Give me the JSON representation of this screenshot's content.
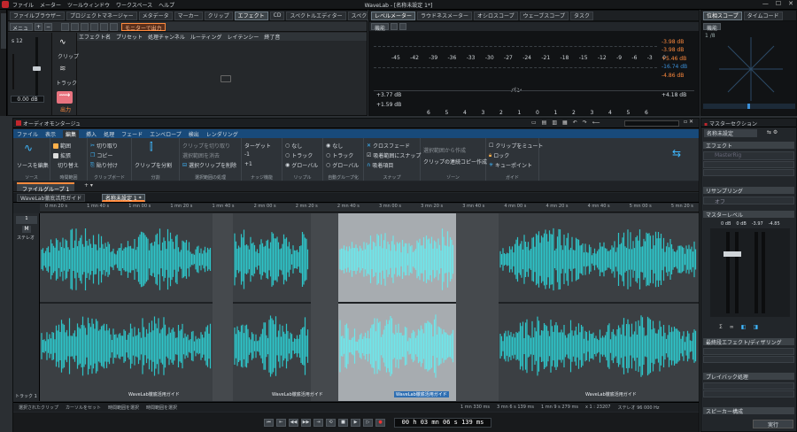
{
  "window": {
    "title": "WaveLab - [名称未設定 1*]",
    "menu": [
      "ファイル",
      "メーター",
      "ツールウィンドウ",
      "ワークスペース",
      "ヘルプ"
    ]
  },
  "top_tabs_left": [
    "ファイルブラウザー",
    "プロジェクトマネージャー",
    "メタデータ",
    "マーカー",
    "クリップ",
    "エフェクト",
    "CD",
    "スペクトルエディター",
    "スペクトルスコープ"
  ],
  "top_tabs_mid": [
    "レベルメーター",
    "ラウドネスメーター",
    "オシロスコープ",
    "ウェーブスコープ",
    "タスク"
  ],
  "top_tabs_right": [
    "位相スコープ",
    "タイムコード"
  ],
  "effects_panel": {
    "menu_label": "メニュー",
    "monitor_out": "モニターで出力",
    "columns": [
      "エフェクト名",
      "プリセット",
      "処理チャンネル",
      "ルーティング",
      "レイテンシー",
      "終了音"
    ],
    "clip_label": "クリップ",
    "track_label": "トラック",
    "output_label": "出力",
    "gain_value": "0.00 dB",
    "s12": "s 12"
  },
  "level_meter": {
    "function_label": "機能",
    "scale": [
      "-45",
      "-42",
      "-39",
      "-36",
      "-33",
      "-30",
      "-27",
      "-24",
      "-21",
      "-18",
      "-15",
      "-12",
      "-9",
      "-6",
      "-3",
      "0"
    ],
    "pan_label": "パン",
    "right_values": [
      "-3.98 dB",
      "-3.98 dB",
      "+5.46 dB",
      "-16.74 dB",
      "-4.86 dB"
    ],
    "low_left": [
      "+3.77 dB",
      "+1.59 dB"
    ],
    "low_right": "+4.18 dB",
    "bottom_scale": [
      "6",
      "5",
      "4",
      "3",
      "2",
      "1",
      "0",
      "1",
      "2",
      "3",
      "4",
      "5",
      "6"
    ]
  },
  "phase_scope": {
    "function_label": "機能",
    "value": "1 /8"
  },
  "audio_montage": {
    "title": "オーディオモンタージュ",
    "ribbon_tabs": [
      "ファイル",
      "表示",
      "編集",
      "挿入",
      "処理",
      "フェード",
      "エンベロープ",
      "検出",
      "レンダリング"
    ],
    "active_tab": "編集",
    "groups": [
      {
        "label": "ソース",
        "items": [
          "ソースを編集"
        ]
      },
      {
        "label": "時間範囲",
        "items": [
          "範囲",
          "拡張",
          "切り替え"
        ]
      },
      {
        "label": "クリップボード",
        "items": [
          "切り取り",
          "コピー",
          "貼り付け"
        ]
      },
      {
        "label": "分割",
        "items": [
          "クリップを分割"
        ]
      },
      {
        "label": "選択範囲の処理",
        "items": [
          "クリップを切り取り",
          "選択範囲を消去",
          "選択クリップを削除"
        ]
      },
      {
        "label": "ナッジ機能",
        "items": [
          "ターゲット",
          "-1",
          "+1"
        ]
      },
      {
        "label": "リップル",
        "items": [
          "なし",
          "トラック",
          "グローバル"
        ]
      },
      {
        "label": "自動グループ化",
        "items": [
          "なし",
          "トラック",
          "グローバル"
        ]
      },
      {
        "label": "スナップ",
        "items": [
          "クロスフェード",
          "吸着範囲にスナップ",
          "吸着項目"
        ]
      },
      {
        "label": "ゾーン",
        "items": [
          "選択範囲から作成",
          "クリップの連続コピー作成"
        ]
      },
      {
        "label": "ガイド",
        "items": [
          "クリップをミュート",
          "ロック",
          "キューポイント"
        ]
      }
    ],
    "file_group": "ファイルグループ 1",
    "doc_tabs": [
      "WaveLab徹底活用ガイド",
      "名称未設定 1 *"
    ],
    "track_label": "ステレオ",
    "track_name": "トラック 1",
    "clips": [
      "WaveLab徹底活用ガイド",
      "WaveLab徹底活用ガイド",
      "WaveLab徹底活用ガイド",
      "WaveLab徹底活用ガイド"
    ],
    "ruler": [
      "0 mn 20 s",
      "1 mn 40 s",
      "1 mn 00 s",
      "1 mn 20 s",
      "1 mn 40 s",
      "2 mn 00 s",
      "2 mn 20 s",
      "2 mn 40 s",
      "3 mn 00 s",
      "3 mn 20 s",
      "3 mn 40 s",
      "4 mn 00 s",
      "4 mn 20 s",
      "4 mn 40 s",
      "5 mn 00 s",
      "5 mn 20 s"
    ],
    "status": [
      "選択されたクリップ",
      "カーソルをセット",
      "時間範囲を選択",
      "時間範囲を選択"
    ],
    "status_right": [
      "1 mn 330 ms",
      "3 mn 6 s 139 ms",
      "1 mn 9 s 279 ms",
      "x 1 : 23207",
      "ステレオ 96 000 Hz"
    ],
    "transport_time": "00 h 03 mn 06 s 139 ms"
  },
  "master": {
    "title": "マスターセクション",
    "preset": "名称未設定",
    "effects": "エフェクト",
    "effect_slot": "MasterRig",
    "resampling": "リサンプリング",
    "resample_slot": "オフ",
    "master_level": "マスターレベル",
    "level_values": [
      "0 dB",
      "0 dB",
      "-3.97",
      "-4.85"
    ],
    "final_effects": "最終段エフェクト/ディザリング",
    "playback": "プレイバック処理",
    "speaker": "スピーカー構成",
    "render": "実行"
  },
  "colors": {
    "accent": "#ff8a3d",
    "wave": "#2ec4c8",
    "wave_sel": "#6ee6ea",
    "clip_bg": "#3b3f43",
    "selected_clip": "#a7acb0"
  }
}
